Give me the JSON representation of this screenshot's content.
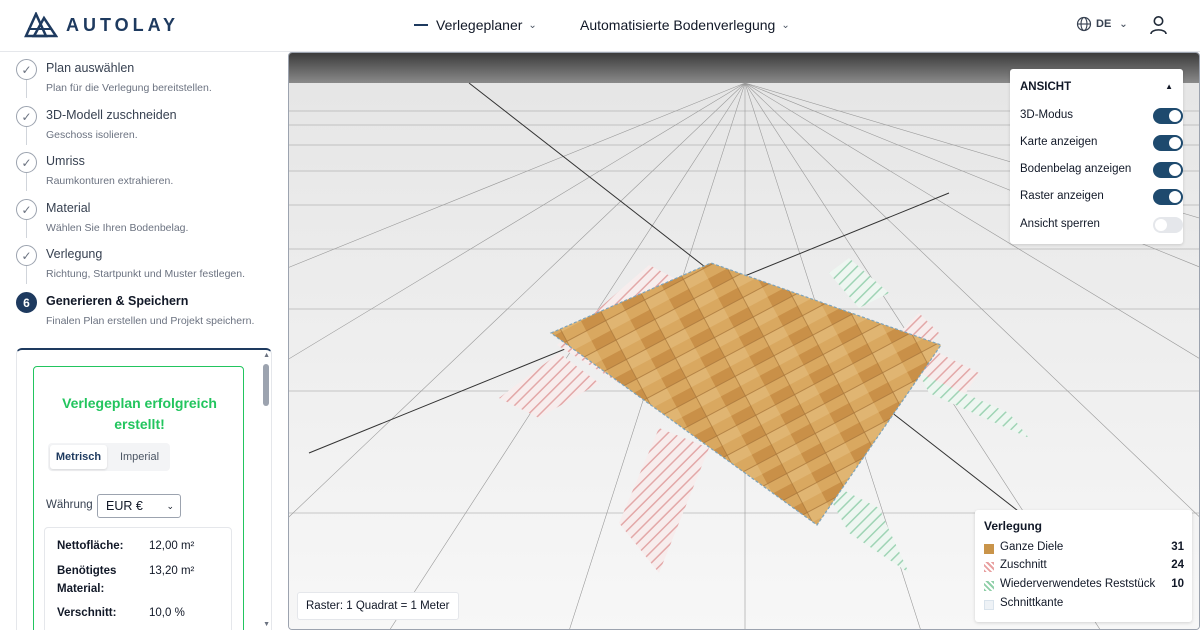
{
  "header": {
    "logo_text": "AUTOLAY",
    "nav_planner": "Verlegeplaner",
    "nav_auto": "Automatisierte Bodenverlegung",
    "language": "DE"
  },
  "steps": [
    {
      "title": "Plan auswählen",
      "desc": "Plan für die Verlegung bereitstellen.",
      "state": "done"
    },
    {
      "title": "3D-Modell zuschneiden",
      "desc": "Geschoss isolieren.",
      "state": "done"
    },
    {
      "title": "Umriss",
      "desc": "Raumkonturen extrahieren.",
      "state": "done"
    },
    {
      "title": "Material",
      "desc": "Wählen Sie Ihren Bodenbelag.",
      "state": "done"
    },
    {
      "title": "Verlegung",
      "desc": "Richtung, Startpunkt und Muster festlegen.",
      "state": "done"
    },
    {
      "title": "Generieren & Speichern",
      "desc": "Finalen Plan erstellen und Projekt speichern.",
      "state": "active",
      "number": "6"
    }
  ],
  "result": {
    "success_line1": "Verlegeplan erfolgreich",
    "success_line2": "erstellt!",
    "unit_metric": "Metrisch",
    "unit_imperial": "Imperial",
    "currency_label": "Währung",
    "currency_value": "EUR €",
    "stats": [
      {
        "label": "Nettofläche:",
        "value": "12,00 m²"
      },
      {
        "label": "Benötigtes Material:",
        "value": "13,20 m²"
      },
      {
        "label": "Verschnitt:",
        "value": "10,0 %"
      }
    ]
  },
  "view_panel": {
    "title": "ANSICHT",
    "toggles": [
      {
        "label": "3D-Modus",
        "on": true
      },
      {
        "label": "Karte anzeigen",
        "on": true
      },
      {
        "label": "Bodenbelag anzeigen",
        "on": true
      },
      {
        "label": "Raster anzeigen",
        "on": true
      },
      {
        "label": "Ansicht sperren",
        "on": false
      }
    ]
  },
  "legend": {
    "title": "Verlegung",
    "items": [
      {
        "label": "Ganze Diele",
        "count": "31",
        "color": "#c9944a"
      },
      {
        "label": "Zuschnitt",
        "count": "24",
        "color": "#e8a0a0"
      },
      {
        "label": "Wiederverwendetes Reststück",
        "count": "10",
        "color": "#8fcfa8"
      },
      {
        "label": "Schnittkante",
        "count": "",
        "color": "#d9e3ec"
      }
    ]
  },
  "raster_label": "Raster: 1 Quadrat = 1 Meter",
  "colors": {
    "accent": "#1e3a5f",
    "success": "#22c55e",
    "wood": "#d6a45e"
  }
}
